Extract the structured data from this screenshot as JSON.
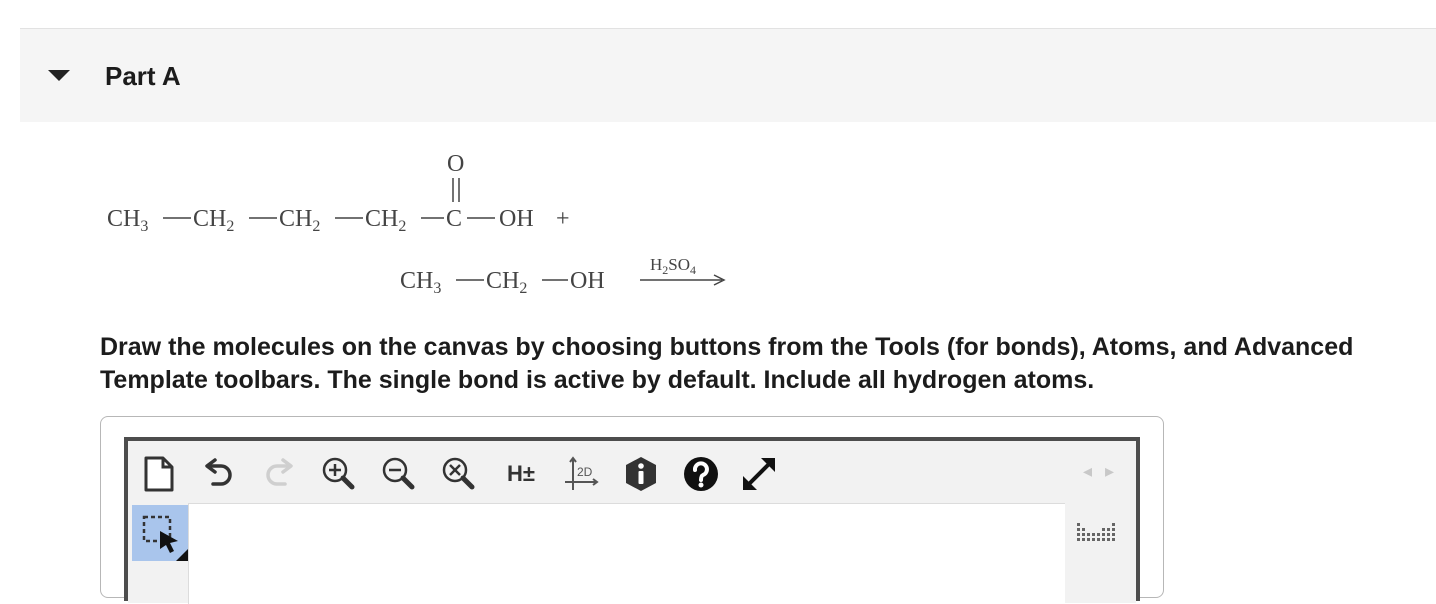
{
  "part": {
    "title": "Part A"
  },
  "reaction": {
    "line1": [
      "CH",
      "3",
      "CH",
      "2",
      "CH",
      "2",
      "CH",
      "2",
      "C",
      "OH",
      "+"
    ],
    "carbonyl_o": "O",
    "line2_ch3": "CH",
    "line2_ch3_sub": "3",
    "line2_ch2": "CH",
    "line2_ch2_sub": "2",
    "line2_oh": "OH",
    "catalyst_h": "H",
    "catalyst_h_sub": "2",
    "catalyst_so": "SO",
    "catalyst_so_sub": "4"
  },
  "instructions": "Draw the molecules on the canvas by choosing buttons from the Tools (for bonds), Atoms, and Advanced Template toolbars. The single bond is active by default. Include all hydrogen atoms.",
  "toolbar": {
    "buttons": [
      {
        "name": "new-document",
        "icon": "new-document-icon"
      },
      {
        "name": "undo",
        "icon": "undo-icon"
      },
      {
        "name": "redo",
        "icon": "redo-icon"
      },
      {
        "name": "zoom-in",
        "icon": "zoom-in-icon"
      },
      {
        "name": "zoom-out",
        "icon": "zoom-out-icon"
      },
      {
        "name": "zoom-reset",
        "icon": "zoom-reset-icon"
      },
      {
        "name": "toggle-hydrogens",
        "label": "H±"
      },
      {
        "name": "clean-2d",
        "label": "2D"
      },
      {
        "name": "info",
        "icon": "info-hexagon-icon"
      },
      {
        "name": "help",
        "icon": "help-circle-icon"
      },
      {
        "name": "fullscreen",
        "icon": "expand-arrows-icon"
      }
    ],
    "h_toggle_label": "H±",
    "clean_label": "2D",
    "nav_arrows": "◂ ▸"
  },
  "colors": {
    "header_bg": "#f5f5f5",
    "select_tool_bg": "#a9c5ec",
    "frame_border": "#4d4d4d"
  }
}
